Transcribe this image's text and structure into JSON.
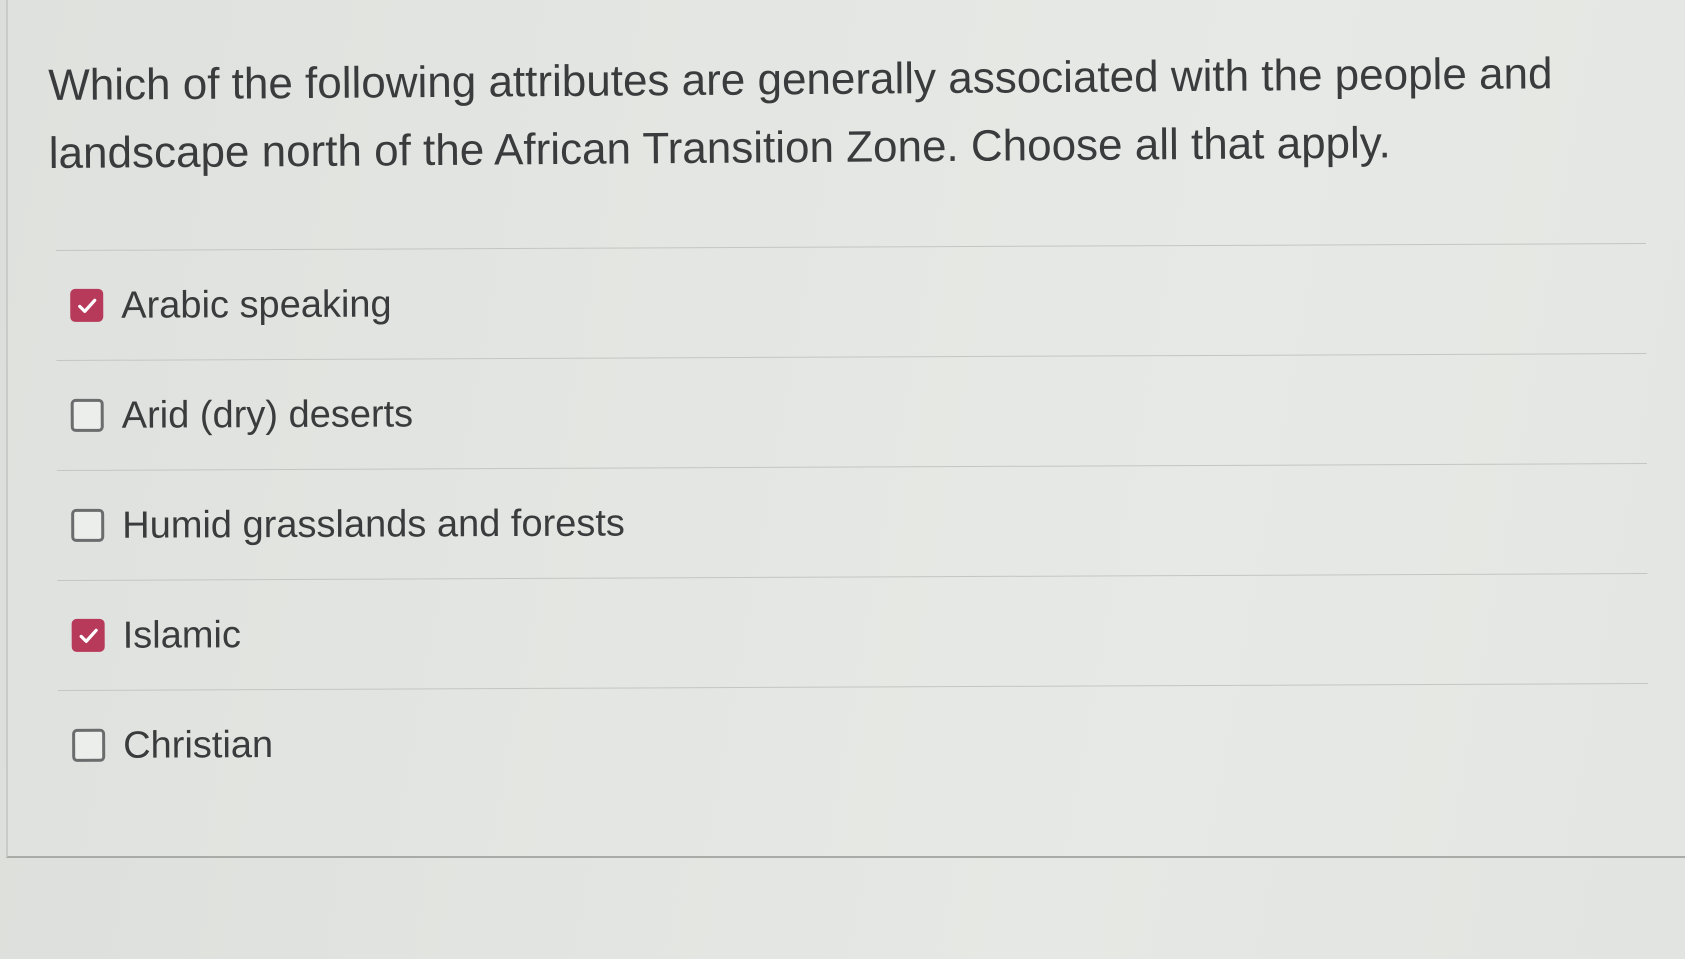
{
  "question": {
    "text": "Which of the following attributes are generally associated with the people and landscape north of the African Transition Zone. Choose all that apply."
  },
  "options": [
    {
      "label": "Arabic speaking",
      "checked": true
    },
    {
      "label": "Arid (dry) deserts",
      "checked": false
    },
    {
      "label": "Humid grasslands and forests",
      "checked": false
    },
    {
      "label": "Islamic",
      "checked": true
    },
    {
      "label": "Christian",
      "checked": false
    }
  ],
  "colors": {
    "checked_fill": "#b83a5a",
    "text": "#3a3b3c",
    "unchecked_border": "#6b6c6d"
  },
  "icons": {
    "checked": "checkmark-icon"
  }
}
